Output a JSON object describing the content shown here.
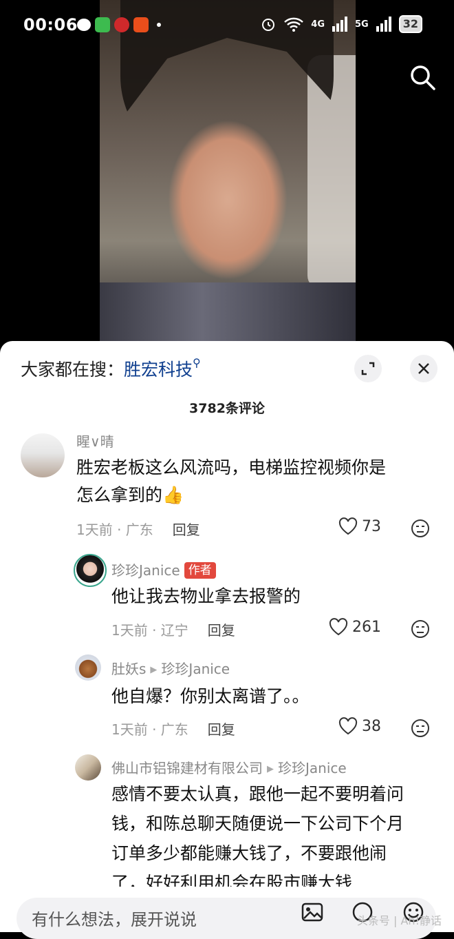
{
  "status": {
    "time": "00:06",
    "net1": "4G",
    "net2": "5G",
    "battery": "32"
  },
  "sheet": {
    "hot_search_prefix": "大家都在搜：",
    "hot_search_keyword": "胜宏科技",
    "comment_count": "3782条评论"
  },
  "comments": [
    {
      "user": "睲∨晴",
      "text_line1": "胜宏老板这么风流吗，电梯监控视频你是",
      "text_line2": "怎么拿到的👍",
      "time_loc": "1天前 · 广东",
      "reply": "回复",
      "likes": "73"
    },
    {
      "user": "珍珍Janice",
      "tag": "作者",
      "text": "他让我去物业拿去报警的",
      "time_loc": "1天前 · 辽宁",
      "reply": "回复",
      "likes": "261"
    },
    {
      "user": "肚妖s",
      "reply_to": "珍珍Janice",
      "text": "他自爆？你别太离谱了。。",
      "time_loc": "1天前 · 广东",
      "reply": "回复",
      "likes": "38"
    },
    {
      "user": "佛山市铝锦建材有限公司",
      "reply_to": "珍珍Janice",
      "lines": [
        "感情不要太认真，跟他一起不要明着问",
        "钱，和陈总聊天随便说一下公司下个月",
        "订单多少都能赚大钱了，不要跟他闹",
        "了，好好利用机会在股市赚大钱"
      ]
    }
  ],
  "bottom": {
    "placeholder": "有什么想法，展开说说",
    "watermark": "头条号 | Ah!静话"
  }
}
